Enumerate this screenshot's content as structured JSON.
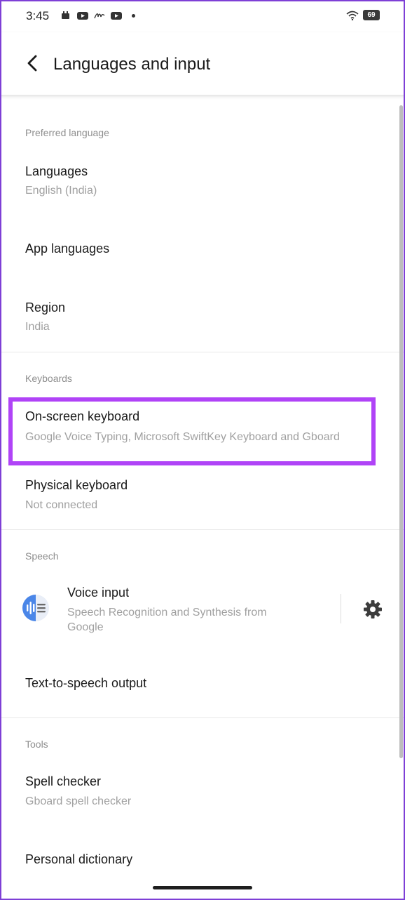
{
  "status_bar": {
    "time": "3:45",
    "battery": "69",
    "icons": [
      "notification-icon",
      "youtube-icon",
      "signature-icon",
      "youtube-icon",
      "dot-icon",
      "wifi-icon",
      "battery-icon"
    ]
  },
  "app_bar": {
    "title": "Languages and input",
    "back_icon": "back-arrow-icon"
  },
  "sections": {
    "preferred_language": {
      "header": "Preferred language",
      "items": [
        {
          "title": "Languages",
          "subtitle": "English (India)"
        },
        {
          "title": "App languages"
        },
        {
          "title": "Region",
          "subtitle": "India"
        }
      ]
    },
    "keyboards": {
      "header": "Keyboards",
      "items": [
        {
          "title": "On-screen keyboard",
          "subtitle": "Google Voice Typing, Microsoft SwiftKey Keyboard and Gboard"
        },
        {
          "title": "Physical keyboard",
          "subtitle": "Not connected"
        }
      ]
    },
    "speech": {
      "header": "Speech",
      "items": [
        {
          "title": "Voice input",
          "subtitle_line1": "Speech Recognition and Synthesis from",
          "subtitle_line2": "Google",
          "icon": "google-voice-icon",
          "action_icon": "gear-icon"
        },
        {
          "title": "Text-to-speech output"
        }
      ]
    },
    "tools": {
      "header": "Tools",
      "items": [
        {
          "title": "Spell checker",
          "subtitle": "Gboard spell checker"
        },
        {
          "title": "Personal dictionary"
        }
      ]
    }
  },
  "colors": {
    "highlight": "#b043f7",
    "frame": "#7e3fd6",
    "secondary_text": "#a0a0a0"
  }
}
